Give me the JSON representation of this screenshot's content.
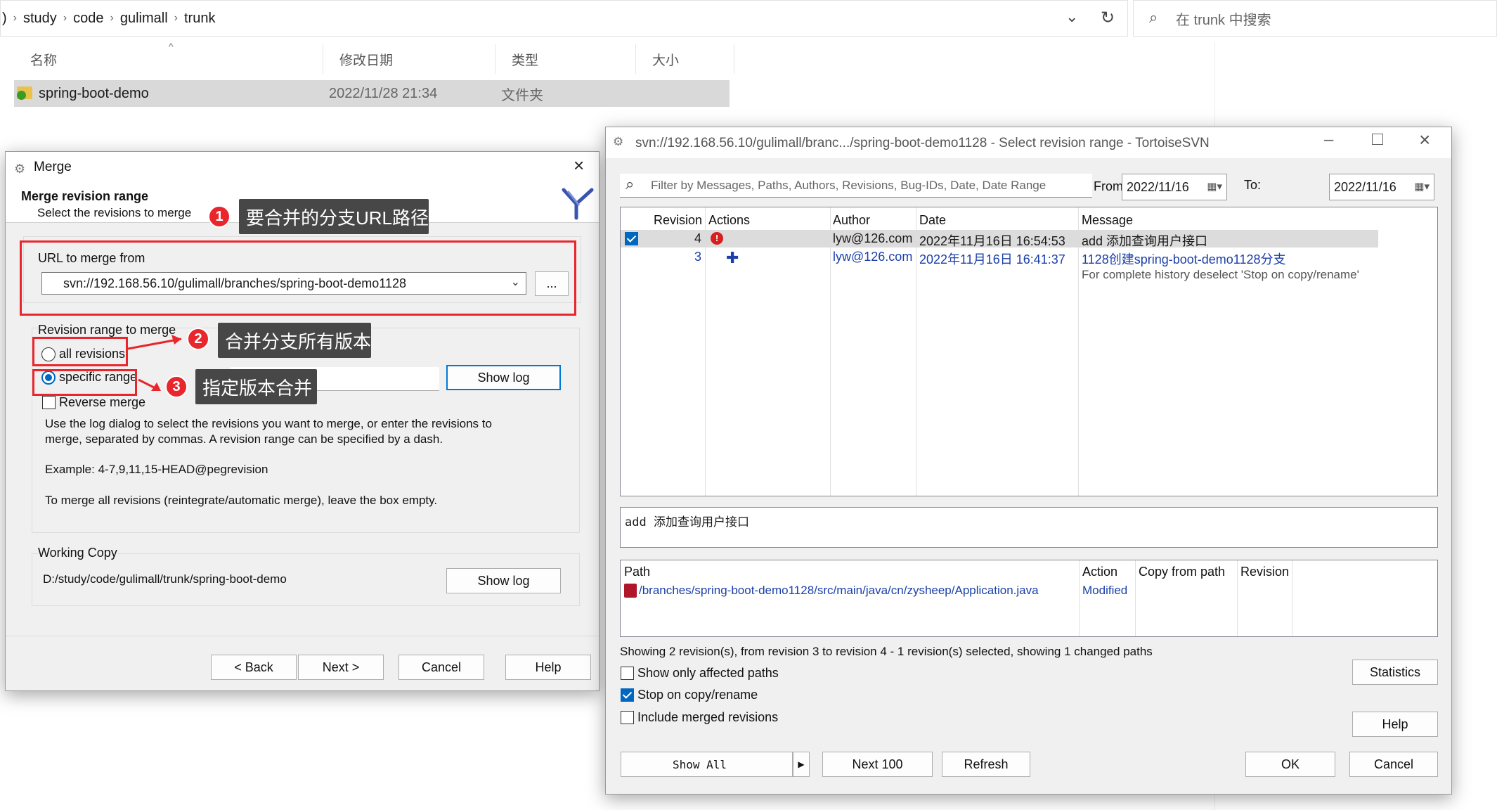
{
  "explorer": {
    "breadcrumb": [
      "study",
      "code",
      "gulimall",
      "trunk"
    ],
    "search_placeholder": "在 trunk 中搜索",
    "columns": [
      "名称",
      "修改日期",
      "类型",
      "大小"
    ],
    "file": {
      "name": "spring-boot-demo",
      "date": "2022/11/28 21:34",
      "type": "文件夹"
    }
  },
  "merge": {
    "title": "Merge",
    "heading": "Merge revision range",
    "subheading": "Select the revisions to merge",
    "url_label": "URL to merge from",
    "url_value": "svn://192.168.56.10/gulimall/branches/spring-boot-demo1128",
    "browse_label": "...",
    "range_label": "Revision range to merge",
    "all_revisions": "all revisions",
    "specific_range": "specific range",
    "show_log": "Show log",
    "reverse_merge": "Reverse merge",
    "help_text_1": "Use the log dialog to select the revisions you want to merge, or enter the revisions to",
    "help_text_2": "merge, separated by commas. A revision range can be specified by a dash.",
    "example": "Example: 4-7,9,11,15-HEAD@pegrevision",
    "empty_note": "To merge all revisions (reintegrate/automatic merge), leave the box empty.",
    "wc_label": "Working Copy",
    "wc_path": "D:/study/code/gulimall/trunk/spring-boot-demo",
    "wc_show_log": "Show log",
    "back": "< Back",
    "next": "Next >",
    "cancel": "Cancel",
    "help": "Help"
  },
  "annotations": {
    "one": {
      "num": "1",
      "text": "要合并的分支URL路径"
    },
    "two": {
      "num": "2",
      "text": "合并分支所有版本"
    },
    "three": {
      "num": "3",
      "text": "指定版本合并"
    }
  },
  "log": {
    "title": "svn://192.168.56.10/gulimall/branc.../spring-boot-demo1128 - Select revision range - TortoiseSVN",
    "filter_placeholder": "Filter by Messages, Paths, Authors, Revisions, Bug-IDs, Date, Date Range",
    "from_label": "From:",
    "from_value": "2022/11/16",
    "to_label": "To:",
    "to_value": "2022/11/16",
    "columns": [
      "Revision",
      "Actions",
      "Author",
      "Date",
      "Message"
    ],
    "rows": [
      {
        "revision": "4",
        "author": "lyw@126.com",
        "date": "2022年11月16日 16:54:53",
        "message": "add 添加查询用户接口"
      },
      {
        "revision": "3",
        "author": "lyw@126.com",
        "date": "2022年11月16日 16:41:37",
        "message": "1128创建spring-boot-demo1128分支"
      }
    ],
    "history_note": "For complete history deselect 'Stop on copy/rename'",
    "message_box": "add  添加查询用户接口",
    "path_columns": [
      "Path",
      "Action",
      "Copy from path",
      "Revision"
    ],
    "path_row": {
      "path": "/branches/spring-boot-demo1128/src/main/java/cn/zysheep/Application.java",
      "action": "Modified"
    },
    "status": "Showing 2 revision(s), from revision 3 to revision 4 - 1 revision(s) selected, showing 1 changed paths",
    "show_only_affected": "Show only affected paths",
    "stop_on_copy": "Stop on copy/rename",
    "include_merged": "Include merged revisions",
    "statistics": "Statistics",
    "help": "Help",
    "show_all": "Show All",
    "next100": "Next 100",
    "refresh": "Refresh",
    "ok": "OK",
    "cancel": "Cancel"
  }
}
